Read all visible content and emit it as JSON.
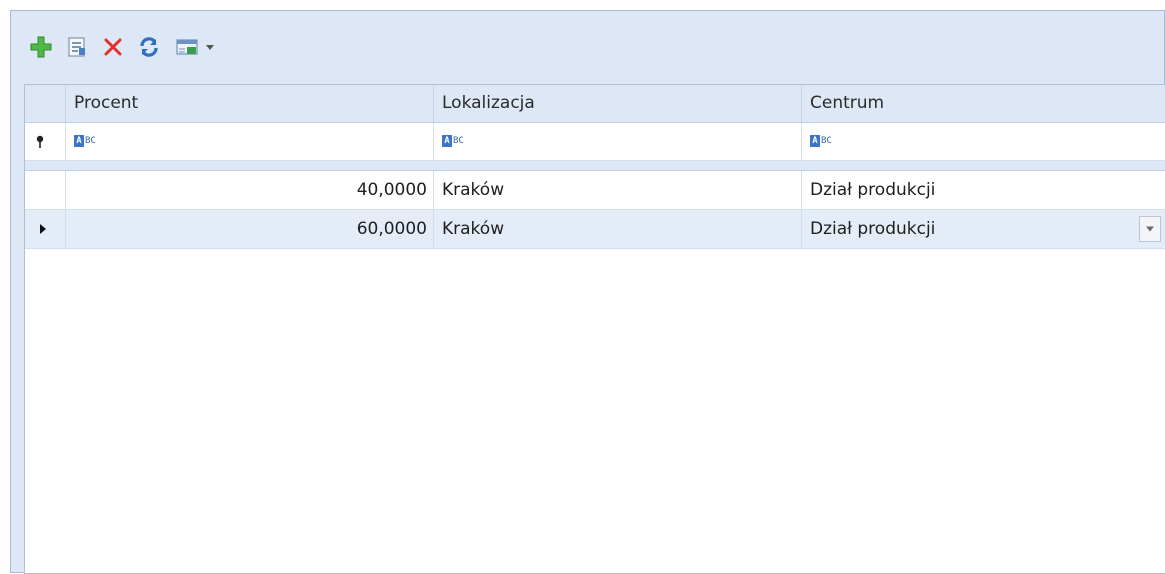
{
  "toolbar": {
    "buttons": [
      {
        "name": "add",
        "icon": "plus-icon",
        "color": "#3aa536"
      },
      {
        "name": "edit",
        "icon": "edit-document-icon",
        "color": "#6f8fb8"
      },
      {
        "name": "delete",
        "icon": "x-delete-icon",
        "color": "#e0312a"
      },
      {
        "name": "refresh",
        "icon": "refresh-icon",
        "color": "#2d6fc2"
      },
      {
        "name": "export",
        "icon": "grid-export-icon",
        "color": "#5a8ac9"
      }
    ]
  },
  "grid": {
    "columns": [
      {
        "label": "Procent"
      },
      {
        "label": "Lokalizacja"
      },
      {
        "label": "Centrum"
      }
    ],
    "filter_placeholder_glyph": "BC",
    "filter_placeholder_letter": "A",
    "rows": [
      {
        "procent": "40,0000",
        "lokalizacja": "Kraków",
        "centrum": "Dział produkcji",
        "selected": false
      },
      {
        "procent": "60,0000",
        "lokalizacja": "Kraków",
        "centrum": "Dział produkcji",
        "selected": true
      }
    ]
  },
  "colors": {
    "panel_bg": "#dde7f5",
    "selected_row": "#e4ecf7",
    "grid_lines": "#d3deee"
  }
}
